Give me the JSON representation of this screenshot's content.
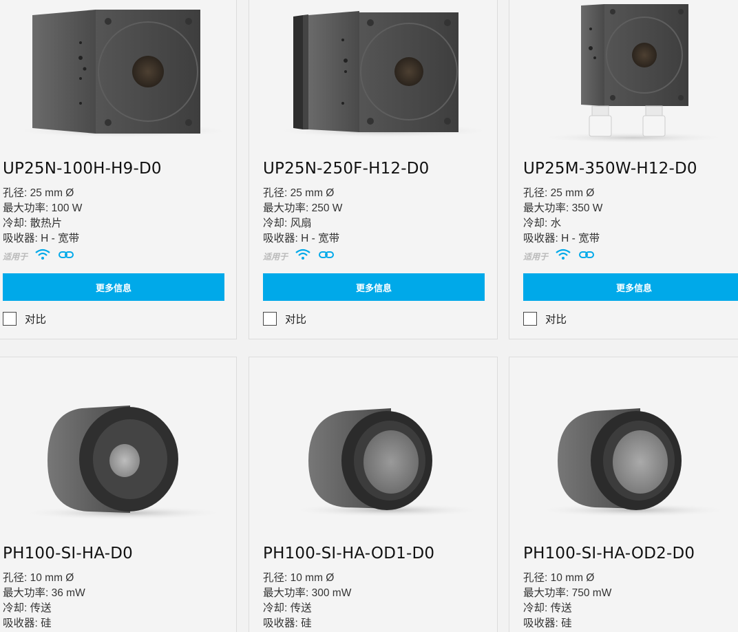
{
  "products": [
    {
      "title": "UP25N-100H-H9-D0",
      "specs": [
        "孔径: 25 mm Ø",
        "最大功率: 100 W",
        "冷却: 散热片",
        "吸收器: H - 宽带"
      ],
      "suitable_label": "适用于",
      "button_label": "更多信息",
      "compare_label": "对比",
      "image": "heatsink-detector"
    },
    {
      "title": "UP25N-250F-H12-D0",
      "specs": [
        "孔径: 25 mm Ø",
        "最大功率: 250 W",
        "冷却: 风扇",
        "吸收器: H - 宽带"
      ],
      "suitable_label": "适用于",
      "button_label": "更多信息",
      "compare_label": "对比",
      "image": "fan-cooled-detector"
    },
    {
      "title": "UP25M-350W-H12-D0",
      "specs": [
        "孔径: 25 mm Ø",
        "最大功率: 350 W",
        "冷却: 水",
        "吸收器: H - 宽带"
      ],
      "suitable_label": "适用于",
      "button_label": "更多信息",
      "compare_label": "对比",
      "image": "water-cooled-detector"
    },
    {
      "title": "PH100-SI-HA-D0",
      "specs": [
        "孔径: 10 mm Ø",
        "最大功率: 36 mW",
        "冷却: 传送",
        "吸收器: 硅"
      ]
    },
    {
      "title": "PH100-SI-HA-OD1-D0",
      "specs": [
        "孔径: 10 mm Ø",
        "最大功率: 300 mW",
        "冷却: 传送",
        "吸收器: 硅"
      ]
    },
    {
      "title": "PH100-SI-HA-OD2-D0",
      "specs": [
        "孔径: 10 mm Ø",
        "最大功率: 750 mW",
        "冷却: 传送",
        "吸收器: 硅"
      ]
    }
  ],
  "colors": {
    "accent": "#00a9e9"
  },
  "icons": [
    "wireless-icon",
    "link-icon"
  ]
}
